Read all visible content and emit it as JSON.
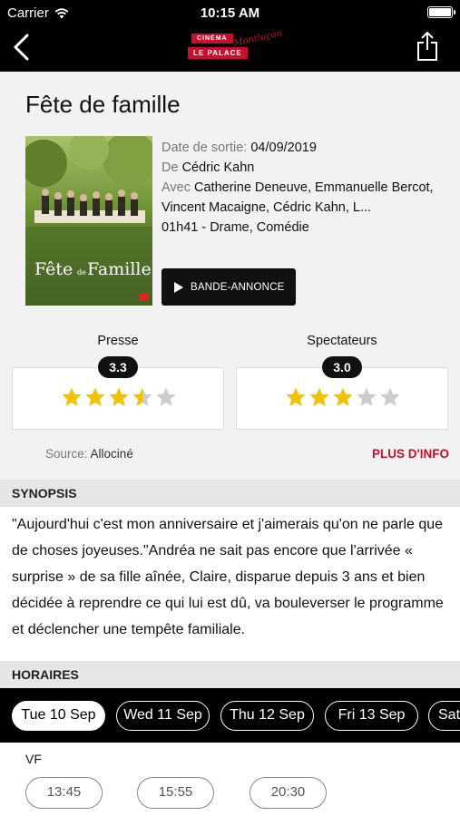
{
  "status_bar": {
    "carrier": "Carrier",
    "time": "10:15 AM"
  },
  "nav": {
    "logo_line1": "CINÉMA",
    "logo_line2": "LE PALACE",
    "logo_script": "Montluçon"
  },
  "movie": {
    "title": "Fête de famille",
    "poster_title_big": "Fête",
    "poster_title_small": "de",
    "poster_title_end": "Famille",
    "release_label": "Date de sortie:",
    "release_value": "04/09/2019",
    "director_label": "De",
    "director_value": "Cédric Kahn",
    "cast_label": "Avec",
    "cast_value": "Catherine Deneuve, Emmanuelle Bercot, Vincent Macaigne, Cédric Kahn, L...",
    "duration_genre": "01h41 - Drame, Comédie",
    "trailer_label": "BANDE-ANNONCE"
  },
  "ratings": {
    "press_label": "Presse",
    "press_score": "3.3",
    "press_stars": 3.5,
    "audience_label": "Spectateurs",
    "audience_score": "3.0",
    "audience_stars": 3,
    "star_color": "#f2c200",
    "star_empty_color": "#cccccc"
  },
  "source": {
    "label": "Source:",
    "value": "Allociné",
    "more_info": "PLUS D'INFO"
  },
  "synopsis": {
    "header": "SYNOPSIS",
    "text": "\"Aujourd'hui c'est mon anniversaire et j'aimerais qu'on ne parle que de choses joyeuses.\"Andréa ne sait pas encore que l'arrivée « surprise » de sa fille aînée, Claire, disparue depuis 3 ans et bien décidée à reprendre ce qui lui est dû, va bouleverser le programme et déclencher une tempête familiale."
  },
  "showtimes": {
    "header": "HORAIRES",
    "days": [
      "Tue 10 Sep",
      "Wed 11 Sep",
      "Thu 12 Sep",
      "Fri 13 Sep",
      "Sat"
    ],
    "active_day": 0,
    "language": "VF",
    "times": [
      "13:45",
      "15:55",
      "20:30"
    ]
  },
  "colors": {
    "accent_red": "#c8102e",
    "header_bg": "#000000"
  }
}
